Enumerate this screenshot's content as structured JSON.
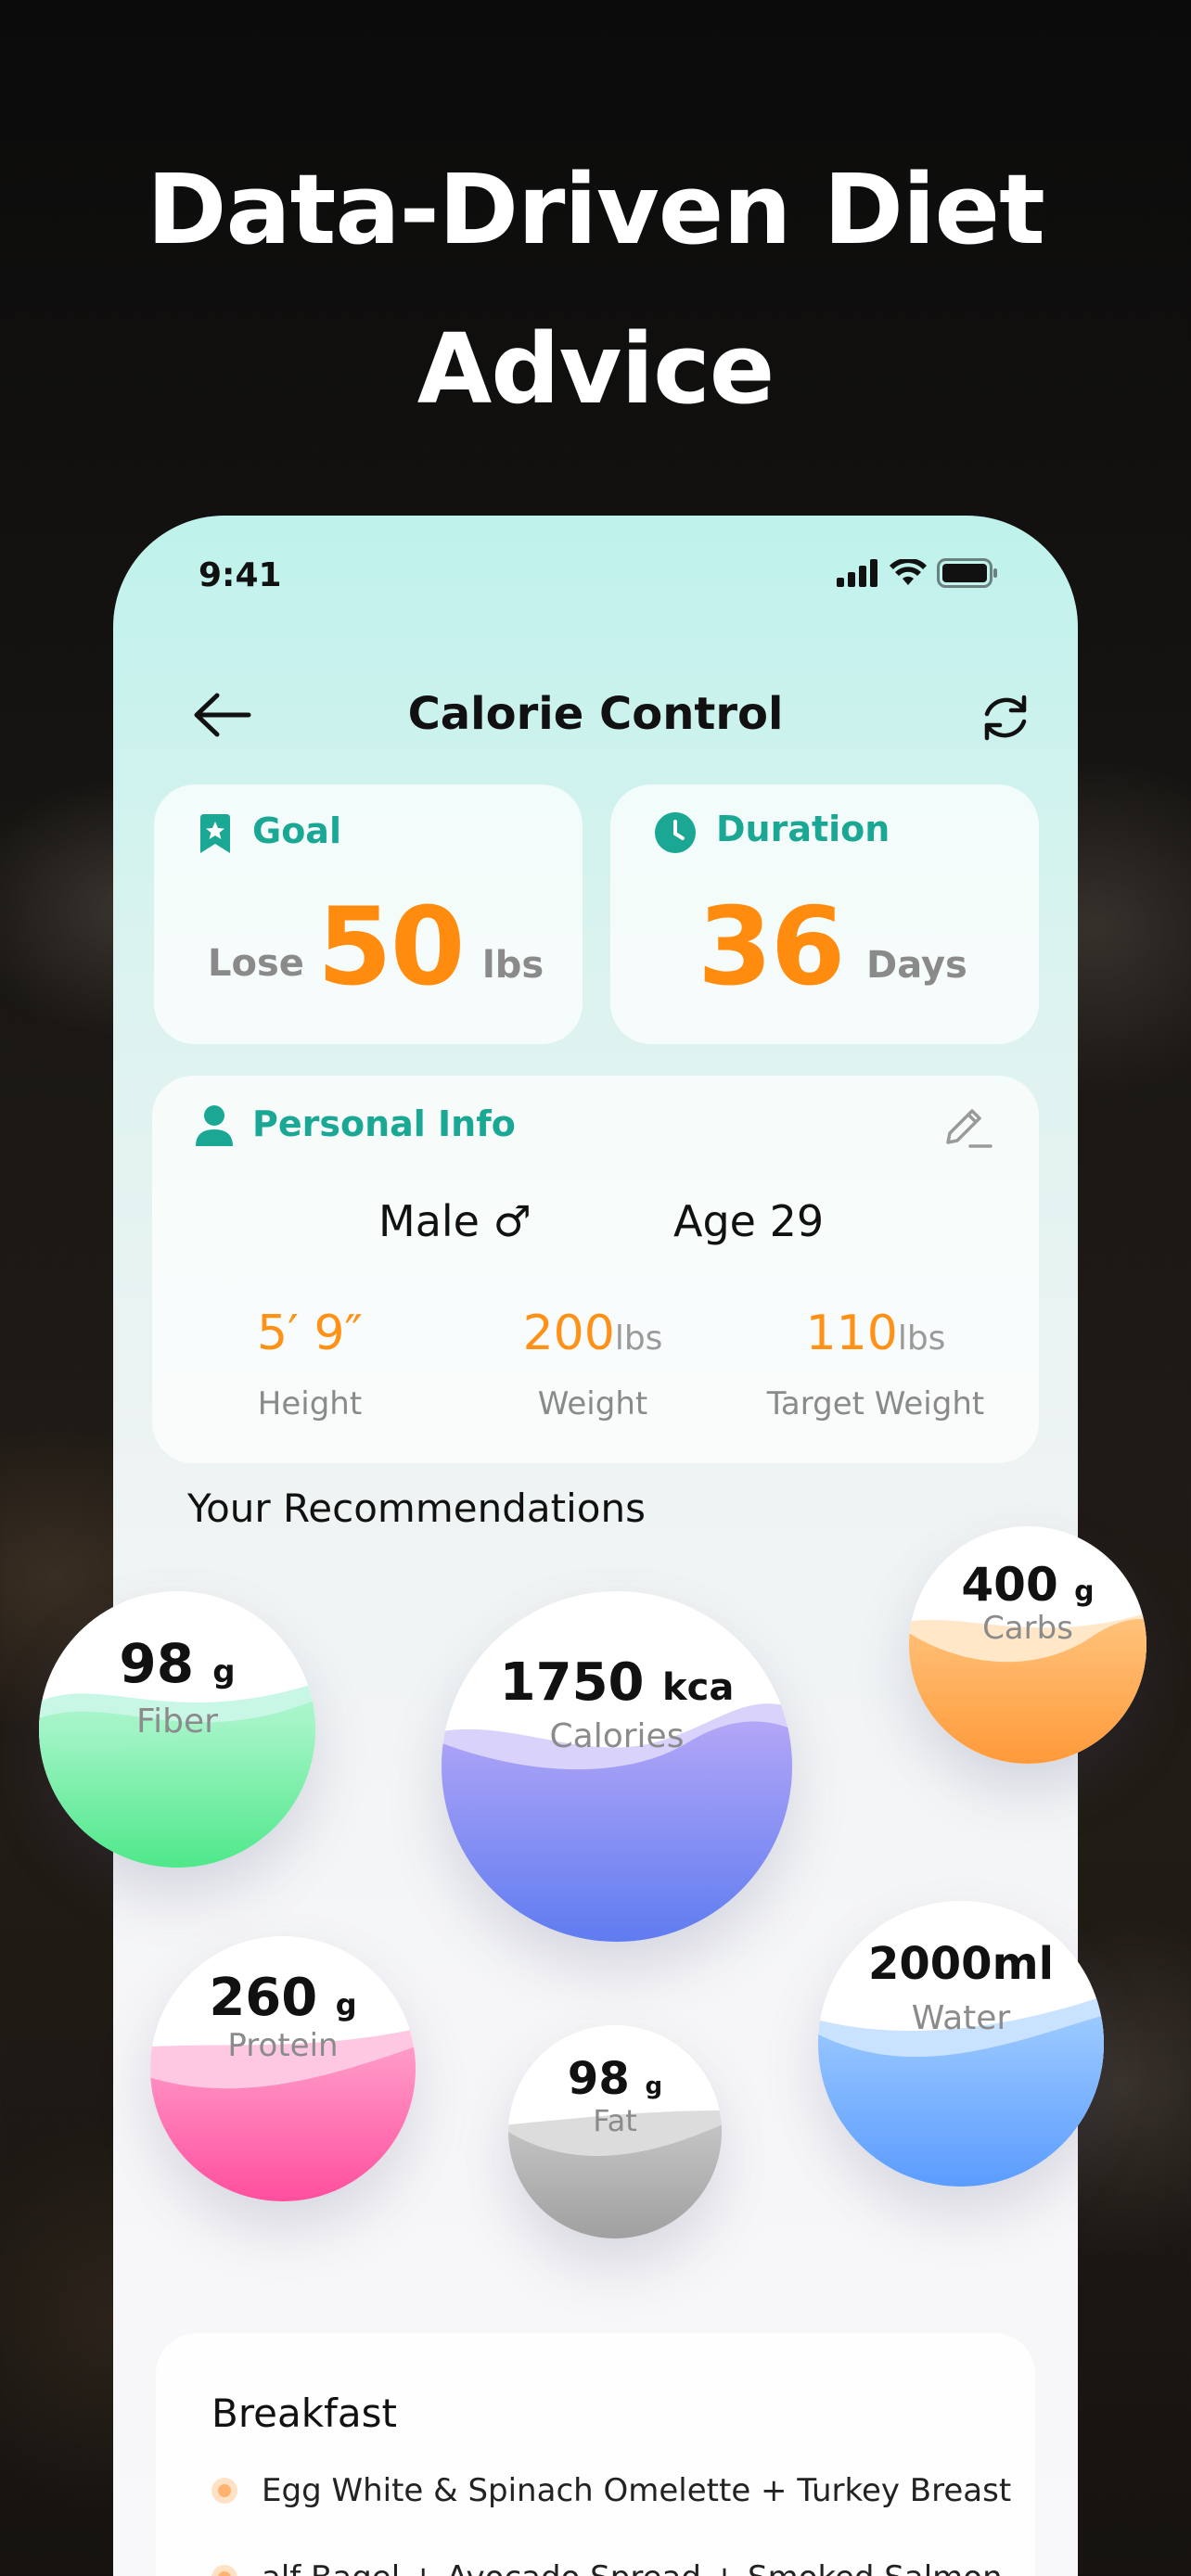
{
  "headline": {
    "line1": "Data-Driven Diet",
    "line2": "Advice"
  },
  "status_bar": {
    "time": "9:41"
  },
  "nav": {
    "title": "Calorie Control"
  },
  "goal": {
    "label": "Goal",
    "prefix": "Lose",
    "value": "50",
    "unit": "lbs"
  },
  "duration": {
    "label": "Duration",
    "value": "36",
    "unit": "Days"
  },
  "personal_info": {
    "label": "Personal Info",
    "gender": "Male ♂",
    "age": "Age 29",
    "stats": [
      {
        "value": "5′ 9″",
        "unit": "",
        "label": "Height"
      },
      {
        "value": "200",
        "unit": "lbs",
        "label": "Weight"
      },
      {
        "value": "110",
        "unit": "lbs",
        "label": "Target Weight"
      }
    ]
  },
  "recommendations": {
    "title": "Your Recommendations",
    "fiber": {
      "value": "98",
      "unit": "g",
      "label": "Fiber"
    },
    "calories": {
      "value": "1750",
      "unit": "kca",
      "label": "Calories"
    },
    "carbs": {
      "value": "400",
      "unit": "g",
      "label": "Carbs"
    },
    "protein": {
      "value": "260",
      "unit": "g",
      "label": "Protein"
    },
    "fat": {
      "value": "98",
      "unit": "g",
      "label": "Fat"
    },
    "water": {
      "value": "2000ml",
      "unit": "",
      "label": "Water"
    }
  },
  "breakfast": {
    "title": "Breakfast",
    "items": [
      "Egg White & Spinach Omelette + Turkey Breast",
      "alf Bagel + Avocado Spread + Smoked Salmon"
    ]
  },
  "colors": {
    "accent_teal": "#1aa895",
    "accent_orange": "#ff8c0f",
    "fiber": "#5ef0a0",
    "calories": "#8a7cf5",
    "carbs": "#ffa040",
    "protein": "#ff5ca8",
    "fat": "#a8a8a8",
    "water": "#5aa2ff"
  }
}
